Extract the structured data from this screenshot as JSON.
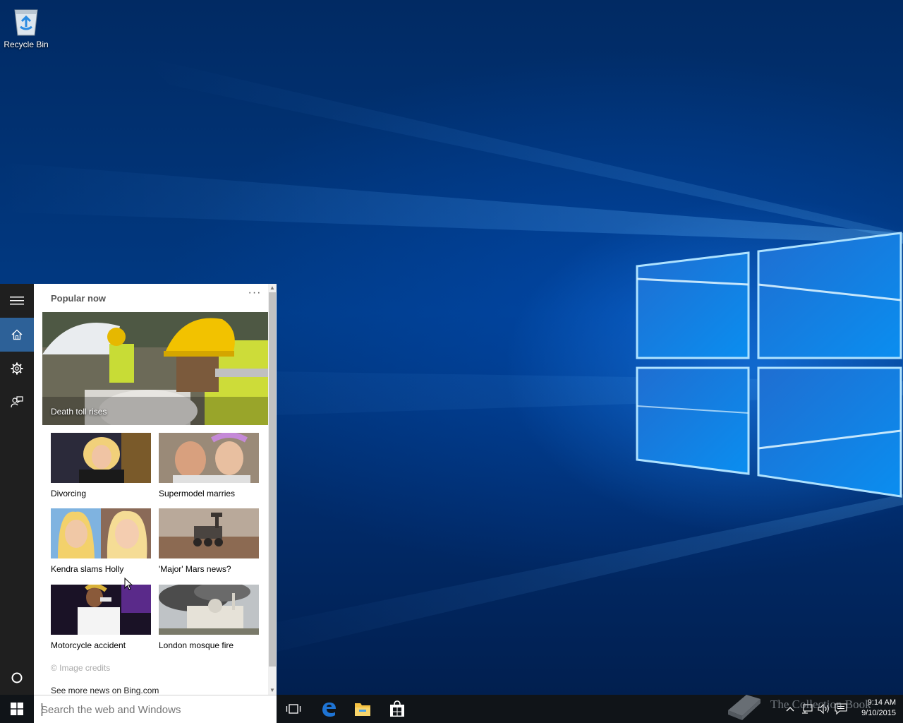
{
  "desktop": {
    "icons": [
      {
        "label": "Recycle Bin",
        "icon": "recycle-bin-icon"
      }
    ]
  },
  "cortana": {
    "rail": [
      {
        "name": "hamburger-menu-icon"
      },
      {
        "name": "home-icon",
        "active": true
      },
      {
        "name": "settings-gear-icon"
      },
      {
        "name": "feedback-icon"
      },
      {
        "name": "cortana-circle-icon"
      }
    ],
    "title": "Popular now",
    "more_label": "···",
    "hero": {
      "caption": "Death toll rises"
    },
    "tiles": [
      {
        "caption": "Divorcing"
      },
      {
        "caption": "Supermodel marries"
      },
      {
        "caption": "Kendra slams Holly"
      },
      {
        "caption": "'Major' Mars news?"
      },
      {
        "caption": "Motorcycle accident"
      },
      {
        "caption": "London mosque fire"
      }
    ],
    "credits": "© Image credits",
    "more_news": "See more news on Bing.com"
  },
  "taskbar": {
    "search_placeholder": "Search the web and Windows",
    "pinned": [
      "task-view-icon",
      "edge-icon",
      "file-explorer-icon",
      "store-icon"
    ],
    "tray": [
      "chevron-up-icon",
      "network-icon",
      "volume-icon",
      "action-center-icon"
    ],
    "time": "9:14 AM",
    "date": "9/10/2015"
  },
  "watermark": {
    "text": "The Collection Book"
  },
  "colors": {
    "rail_bg": "#1f1f1f",
    "rail_active": "#2d6198",
    "taskbar_bg": "#101418",
    "edge_blue": "#1e74d4",
    "explorer_yellow": "#f5c242"
  }
}
